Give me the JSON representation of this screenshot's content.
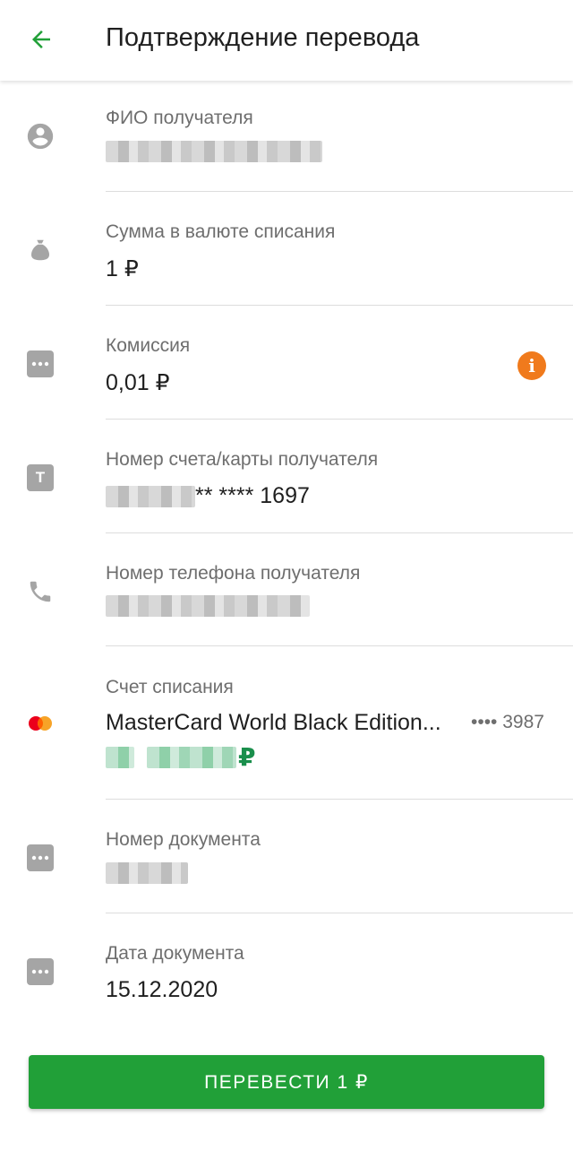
{
  "header": {
    "title": "Подтверждение перевода",
    "back_icon": "arrow-back-icon"
  },
  "colors": {
    "accent": "#21a038",
    "info": "#f07a1c",
    "icon_gray": "#a5a5a5",
    "mastercard_red": "#eb001b",
    "mastercard_orange": "#f79e1b"
  },
  "rows": {
    "recipient_name": {
      "label": "ФИО получателя",
      "icon": "person-icon"
    },
    "amount": {
      "label": "Сумма в валюте списания",
      "value": "1 ₽",
      "icon": "money-bag-icon"
    },
    "commission": {
      "label": "Комиссия",
      "value": "0,01 ₽",
      "icon": "dots-icon",
      "info_icon": "i"
    },
    "account": {
      "label": "Номер счета/карты получателя",
      "value_suffix": "** **** 1697",
      "icon": "t-square-icon",
      "icon_letter": "T"
    },
    "phone": {
      "label": "Номер телефона получателя",
      "icon": "phone-icon"
    },
    "debit_account": {
      "label": "Счет списания",
      "card_name": "MasterCard World Black Edition...",
      "card_mask": "•••• 3987",
      "currency": "₽",
      "icon": "mastercard-icon"
    },
    "document_number": {
      "label": "Номер документа",
      "icon": "dots-icon"
    },
    "document_date": {
      "label": "Дата документа",
      "value": "15.12.2020",
      "icon": "dots-icon"
    }
  },
  "actions": {
    "submit_label": "ПЕРЕВЕСТИ 1 ₽"
  }
}
